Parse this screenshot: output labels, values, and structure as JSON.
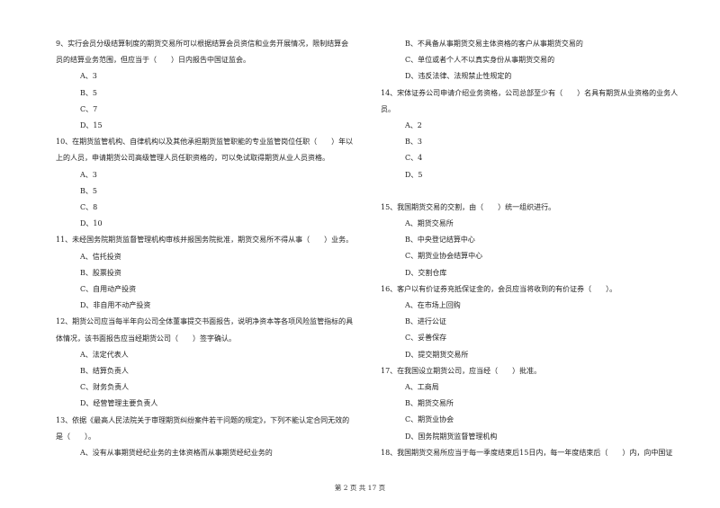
{
  "left_column": [
    {
      "stem_lines": [
        "9、实行会员分级结算制度的期货交易所可以根据结算会员资信和业务开展情况，限制结算会",
        "员的结算业务范围，但应当于（　　）日内报告中国证监会。"
      ],
      "options": [
        "A、3",
        "B、5",
        "C、7",
        "D、15"
      ]
    },
    {
      "stem_lines": [
        "10、在期货监管机构、自律机构以及其他承担期货监管职能的专业监管岗位任职（　　）年以",
        "上的人员，申请期货公司高级管理人员任职资格的，可以免试取得期货从业人员资格。"
      ],
      "options": [
        "A、3",
        "B、5",
        "C、8",
        "D、10"
      ]
    },
    {
      "stem_lines": [
        "11、未经国务院期货监督管理机构审核并报国务院批准，期货交易所不得从事（　　）业务。"
      ],
      "options": [
        "A、信托投资",
        "B、股票投资",
        "C、自用动产投资",
        "D、非自用不动产投资"
      ]
    },
    {
      "stem_lines": [
        "12、期货公司应当每半年向公司全体董事提交书面报告，说明净资本等各项风险监管指标的具",
        "体情况，该书面报告应当经期货公司（　　）签字确认。"
      ],
      "options": [
        "A、法定代表人",
        "B、结算负责人",
        "C、财务负责人",
        "D、经营管理主要负责人"
      ]
    },
    {
      "stem_lines": [
        "13、依据《最高人民法院关于审理期货纠纷案件若干问题的规定》，下列不能认定合同无效的",
        "是（　　）。"
      ],
      "options": [
        "A、没有从事期货经纪业务的主体资格而从事期货经纪业务的"
      ]
    }
  ],
  "right_column": [
    {
      "stem_lines": [],
      "options": [
        "B、不具备从事期货交易主体资格的客户从事期货交易的",
        "C、单位或者个人不以真实身份从事期货交易的",
        "D、违反法律、法规禁止性规定的"
      ]
    },
    {
      "stem_lines": [
        "14、宋体证券公司申请介绍业务资格，公司总部至少有（　　）名具有期货从业资格的业务人",
        "员。"
      ],
      "options": [
        "A、2",
        "B、3",
        "C、4",
        "D、5"
      ]
    },
    {
      "stem_lines": [
        "15、我国期货交易的交割，由（　　）统一组织进行。"
      ],
      "options": [
        "A、期货交易所",
        "B、中央登记结算中心",
        "C、期货业协会结算中心",
        "D、交割仓库"
      ]
    },
    {
      "stem_lines": [
        "16、客户以有价证券充抵保证金的，会员应当将收到的有价证券（　　）。"
      ],
      "options": [
        "A、在市场上回购",
        "B、进行公证",
        "C、妥善保存",
        "D、提交期货交易所"
      ]
    },
    {
      "stem_lines": [
        "17、在我国设立期货公司，应当经（　　）批准。"
      ],
      "options": [
        "A、工商局",
        "B、期货交易所",
        "C、期货业协会",
        "D、国务院期货监督管理机构"
      ]
    },
    {
      "stem_lines": [
        "18、我国期货交易所应当于每一季度结束后15日内，每一年度结束后（　　）内，向中国证"
      ],
      "options": []
    }
  ],
  "footer": {
    "page_label": "第 2 页 共 17 页"
  }
}
